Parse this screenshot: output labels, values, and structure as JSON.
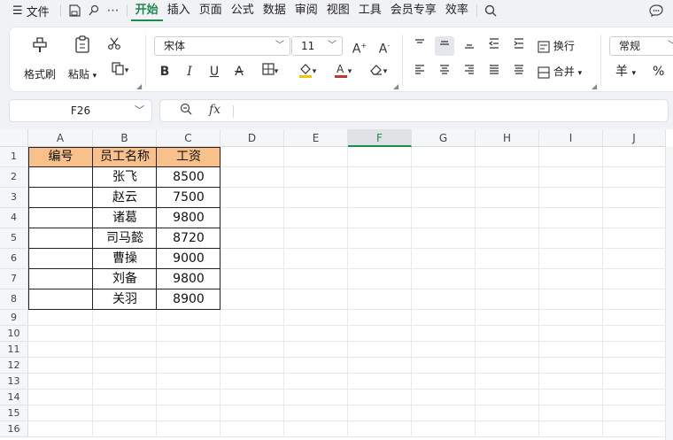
{
  "menubar": {
    "file_label": "文件",
    "tabs": [
      "开始",
      "插入",
      "页面",
      "公式",
      "数据",
      "审阅",
      "视图",
      "工具",
      "会员专享",
      "效率"
    ],
    "active_tab": "开始"
  },
  "ribbon": {
    "format_painter": "格式刷",
    "paste": "粘贴",
    "font_name": "宋体",
    "font_size": "11",
    "wrap_text": "换行",
    "merge": "合并",
    "number_format": "常规",
    "currency_symbol": "羊",
    "percent_symbol": "%"
  },
  "formula_bar": {
    "name_box": "F26",
    "fx_label": "fx",
    "formula": ""
  },
  "sheet": {
    "columns": [
      "A",
      "B",
      "C",
      "D",
      "E",
      "F",
      "G",
      "H",
      "I",
      "J"
    ],
    "selected_column": "F",
    "rows": [
      "1",
      "2",
      "3",
      "4",
      "5",
      "6",
      "7",
      "8",
      "9",
      "10",
      "11",
      "12",
      "13",
      "14",
      "15",
      "16"
    ],
    "table": {
      "headers": [
        "编号",
        "员工名称",
        "工资"
      ],
      "rows": [
        [
          "",
          "张飞",
          "8500"
        ],
        [
          "",
          "赵云",
          "7500"
        ],
        [
          "",
          "诸葛",
          "9800"
        ],
        [
          "",
          "司马懿",
          "8720"
        ],
        [
          "",
          "曹操",
          "9000"
        ],
        [
          "",
          "刘备",
          "9800"
        ],
        [
          "",
          "关羽",
          "8900"
        ]
      ]
    }
  },
  "colors": {
    "accent": "#1e8a4c",
    "header_fill": "#f8c08a",
    "font_color_bar": "#c0392b",
    "highlight_bar": "#f1c40f"
  }
}
